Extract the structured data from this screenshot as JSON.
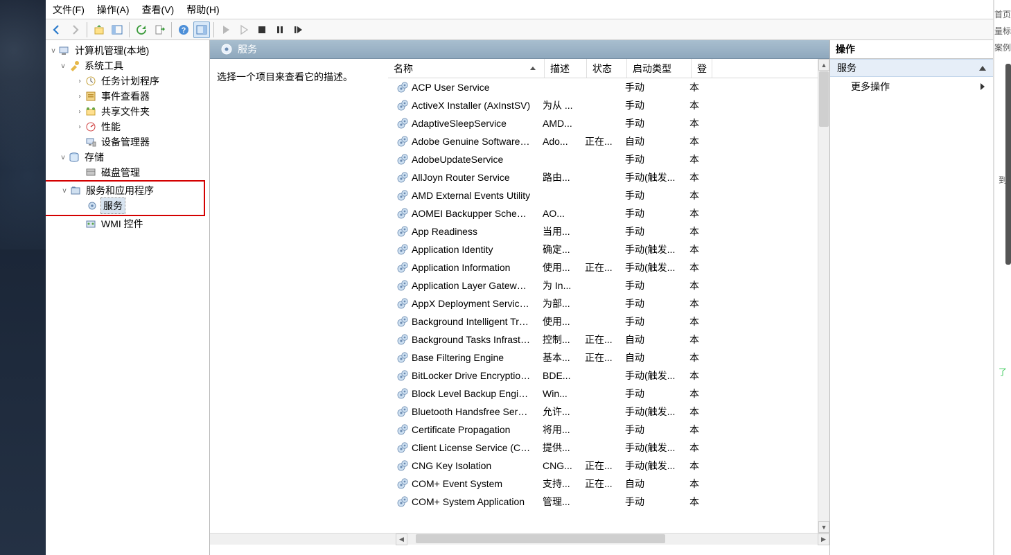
{
  "menu": {
    "file": "文件(F)",
    "action": "操作(A)",
    "view": "查看(V)",
    "help": "帮助(H)"
  },
  "tree": {
    "root": "计算机管理(本地)",
    "sys": "系统工具",
    "task": "任务计划程序",
    "event": "事件查看器",
    "share": "共享文件夹",
    "perf": "性能",
    "devmgr": "设备管理器",
    "storage": "存储",
    "disk": "磁盘管理",
    "svcapp": "服务和应用程序",
    "services": "服务",
    "wmi": "WMI 控件"
  },
  "panel": {
    "title": "服务",
    "desc_hint": "选择一个项目来查看它的描述。",
    "headers": {
      "name": "名称",
      "desc": "描述",
      "status": "状态",
      "start": "启动类型",
      "logon": "登"
    }
  },
  "services": [
    {
      "name": "ACP User Service",
      "desc": "",
      "status": "",
      "start": "手动",
      "log": "本"
    },
    {
      "name": "ActiveX Installer (AxInstSV)",
      "desc": "为从 ...",
      "status": "",
      "start": "手动",
      "log": "本"
    },
    {
      "name": "AdaptiveSleepService",
      "desc": "AMD...",
      "status": "",
      "start": "手动",
      "log": "本"
    },
    {
      "name": "Adobe Genuine Software I...",
      "desc": "Ado...",
      "status": "正在...",
      "start": "自动",
      "log": "本"
    },
    {
      "name": "AdobeUpdateService",
      "desc": "",
      "status": "",
      "start": "手动",
      "log": "本"
    },
    {
      "name": "AllJoyn Router Service",
      "desc": "路由...",
      "status": "",
      "start": "手动(触发...",
      "log": "本"
    },
    {
      "name": "AMD External Events Utility",
      "desc": "",
      "status": "",
      "start": "手动",
      "log": "本"
    },
    {
      "name": "AOMEI Backupper Schedul...",
      "desc": "AO...",
      "status": "",
      "start": "手动",
      "log": "本"
    },
    {
      "name": "App Readiness",
      "desc": "当用...",
      "status": "",
      "start": "手动",
      "log": "本"
    },
    {
      "name": "Application Identity",
      "desc": "确定...",
      "status": "",
      "start": "手动(触发...",
      "log": "本"
    },
    {
      "name": "Application Information",
      "desc": "使用...",
      "status": "正在...",
      "start": "手动(触发...",
      "log": "本"
    },
    {
      "name": "Application Layer Gateway ...",
      "desc": "为 In...",
      "status": "",
      "start": "手动",
      "log": "本"
    },
    {
      "name": "AppX Deployment Service ...",
      "desc": "为部...",
      "status": "",
      "start": "手动",
      "log": "本"
    },
    {
      "name": "Background Intelligent Tra...",
      "desc": "使用...",
      "status": "",
      "start": "手动",
      "log": "本"
    },
    {
      "name": "Background Tasks Infrastru...",
      "desc": "控制...",
      "status": "正在...",
      "start": "自动",
      "log": "本"
    },
    {
      "name": "Base Filtering Engine",
      "desc": "基本...",
      "status": "正在...",
      "start": "自动",
      "log": "本"
    },
    {
      "name": "BitLocker Drive Encryption ...",
      "desc": "BDE...",
      "status": "",
      "start": "手动(触发...",
      "log": "本"
    },
    {
      "name": "Block Level Backup Engine ...",
      "desc": "Win...",
      "status": "",
      "start": "手动",
      "log": "本"
    },
    {
      "name": "Bluetooth Handsfree Service",
      "desc": "允许...",
      "status": "",
      "start": "手动(触发...",
      "log": "本"
    },
    {
      "name": "Certificate Propagation",
      "desc": "将用...",
      "status": "",
      "start": "手动",
      "log": "本"
    },
    {
      "name": "Client License Service (Clip...",
      "desc": "提供...",
      "status": "",
      "start": "手动(触发...",
      "log": "本"
    },
    {
      "name": "CNG Key Isolation",
      "desc": "CNG...",
      "status": "正在...",
      "start": "手动(触发...",
      "log": "本"
    },
    {
      "name": "COM+ Event System",
      "desc": "支持...",
      "status": "正在...",
      "start": "自动",
      "log": "本"
    },
    {
      "name": "COM+ System Application",
      "desc": "管理...",
      "status": "",
      "start": "手动",
      "log": "本"
    }
  ],
  "actions": {
    "title": "操作",
    "sub": "服务",
    "more": "更多操作"
  },
  "right_strip": {
    "a": "首页",
    "b": "量标",
    "c": "案例",
    "d": "了",
    "e": "到"
  }
}
